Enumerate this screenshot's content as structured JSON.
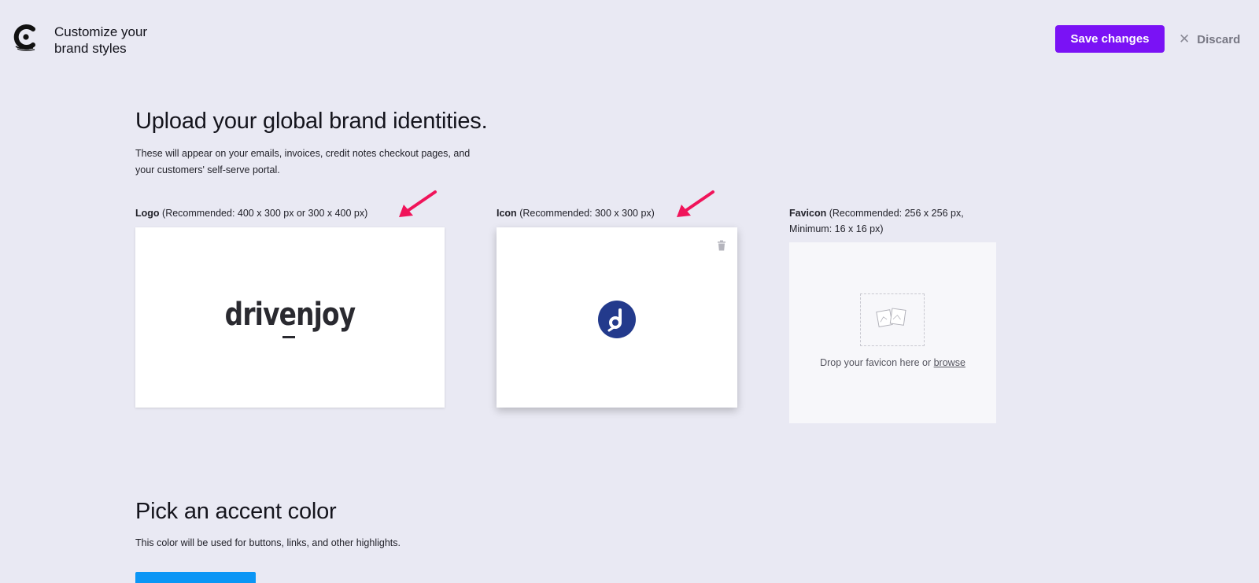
{
  "header": {
    "title": "Customize your brand styles",
    "save_label": "Save changes",
    "discard_label": "Discard",
    "brand_icon": "chargebee-logo-icon"
  },
  "identities": {
    "heading": "Upload your global brand identities.",
    "description_line1": "These will appear on your emails, invoices, credit notes checkout pages, and",
    "description_line2": "your customers' self-serve portal.",
    "logo": {
      "label": "Logo",
      "hint": "(Recommended: 400 x 300 px or 300 x 400 px)",
      "image_text": "drivenjoy"
    },
    "icon": {
      "label": "Icon",
      "hint": "(Recommended: 300 x 300 px)",
      "delete_icon": "trash-icon"
    },
    "favicon": {
      "label": "Favicon",
      "hint_line1": "(Recommended: 256 x 256 px,",
      "hint_line2": "Minimum: 16 x 16 px)",
      "drop_text": "Drop your favicon here or",
      "browse_label": "browse"
    }
  },
  "accent": {
    "heading": "Pick an accent color",
    "description": "This color will be used for buttons, links, and other highlights.",
    "color": "#0b96f5"
  },
  "colors": {
    "primary_button": "#7a12f5",
    "background": "#e9e9f3",
    "annotation_arrow": "#f0145a",
    "icon_brand": "#233a8c"
  }
}
